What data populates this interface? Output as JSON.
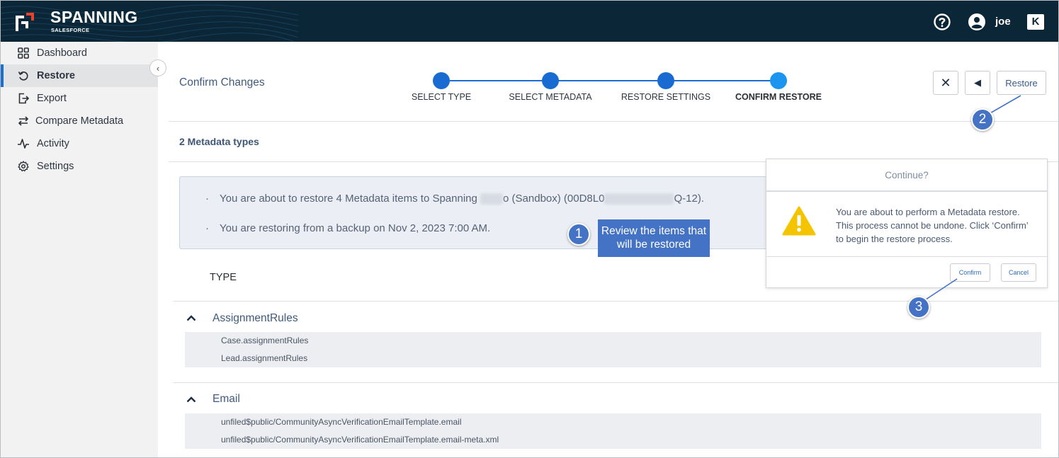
{
  "header": {
    "brand": "SPANNING",
    "brand_sub": "SALESFORCE",
    "user": "joe",
    "kaseya_glyph": "K",
    "icons": [
      "help-circle-icon",
      "user-avatar-icon",
      "kaseya-icon"
    ]
  },
  "sidebar": {
    "items": [
      {
        "label": "Dashboard",
        "icon": "grid-icon"
      },
      {
        "label": "Restore",
        "icon": "restore-icon",
        "active": true
      },
      {
        "label": "Export",
        "icon": "export-icon"
      },
      {
        "label": "Compare Metadata",
        "icon": "compare-arrows-icon"
      },
      {
        "label": "Activity",
        "icon": "activity-pulse-icon"
      },
      {
        "label": "Settings",
        "icon": "gear-icon"
      }
    ],
    "collapse_glyph": "‹"
  },
  "main": {
    "page_title": "Confirm Changes",
    "steps": [
      {
        "label": "SELECT TYPE"
      },
      {
        "label": "SELECT METADATA"
      },
      {
        "label": "RESTORE SETTINGS"
      },
      {
        "label": "CONFIRM RESTORE",
        "current": true
      }
    ],
    "buttons": {
      "close_glyph": "✕",
      "back_glyph": "◀",
      "restore_label": "Restore"
    },
    "metadata_count": "2 Metadata types",
    "info": {
      "bullet": "·",
      "line1_prefix": "You are about to restore 4 Metadata items to Spanning ",
      "line1_middle": "o (Sandbox) (00D8L0",
      "line1_suffix": "Q-12).",
      "line2": "You are restoring from a backup on Nov 2, 2023 7:00 AM."
    },
    "type_header": "TYPE",
    "groups": [
      {
        "name": "AssignmentRules",
        "items": [
          "Case.assignmentRules",
          "Lead.assignmentRules"
        ]
      },
      {
        "name": "Email",
        "items": [
          "unfiled$public/CommunityAsyncVerificationEmailTemplate.email",
          "unfiled$public/CommunityAsyncVerificationEmailTemplate.email-meta.xml"
        ]
      }
    ]
  },
  "dialog": {
    "title": "Continue?",
    "message": "You are about to perform a Metadata restore. This process cannot be undone. Click ‘Confirm’ to begin the restore process.",
    "confirm_label": "Confirm",
    "cancel_label": "Cancel",
    "icon": "warning-triangle-icon"
  },
  "callouts": {
    "c1_number": "1",
    "c1_text": "Review the items that will be restored",
    "c2_number": "2",
    "c3_number": "3"
  },
  "colors": {
    "header_bg": "#0b2637",
    "accent": "#1b6fd3",
    "step_current": "#1b95f0",
    "callout": "#4472c4",
    "warning": "#f5c400",
    "logo_red": "#e8412c"
  }
}
